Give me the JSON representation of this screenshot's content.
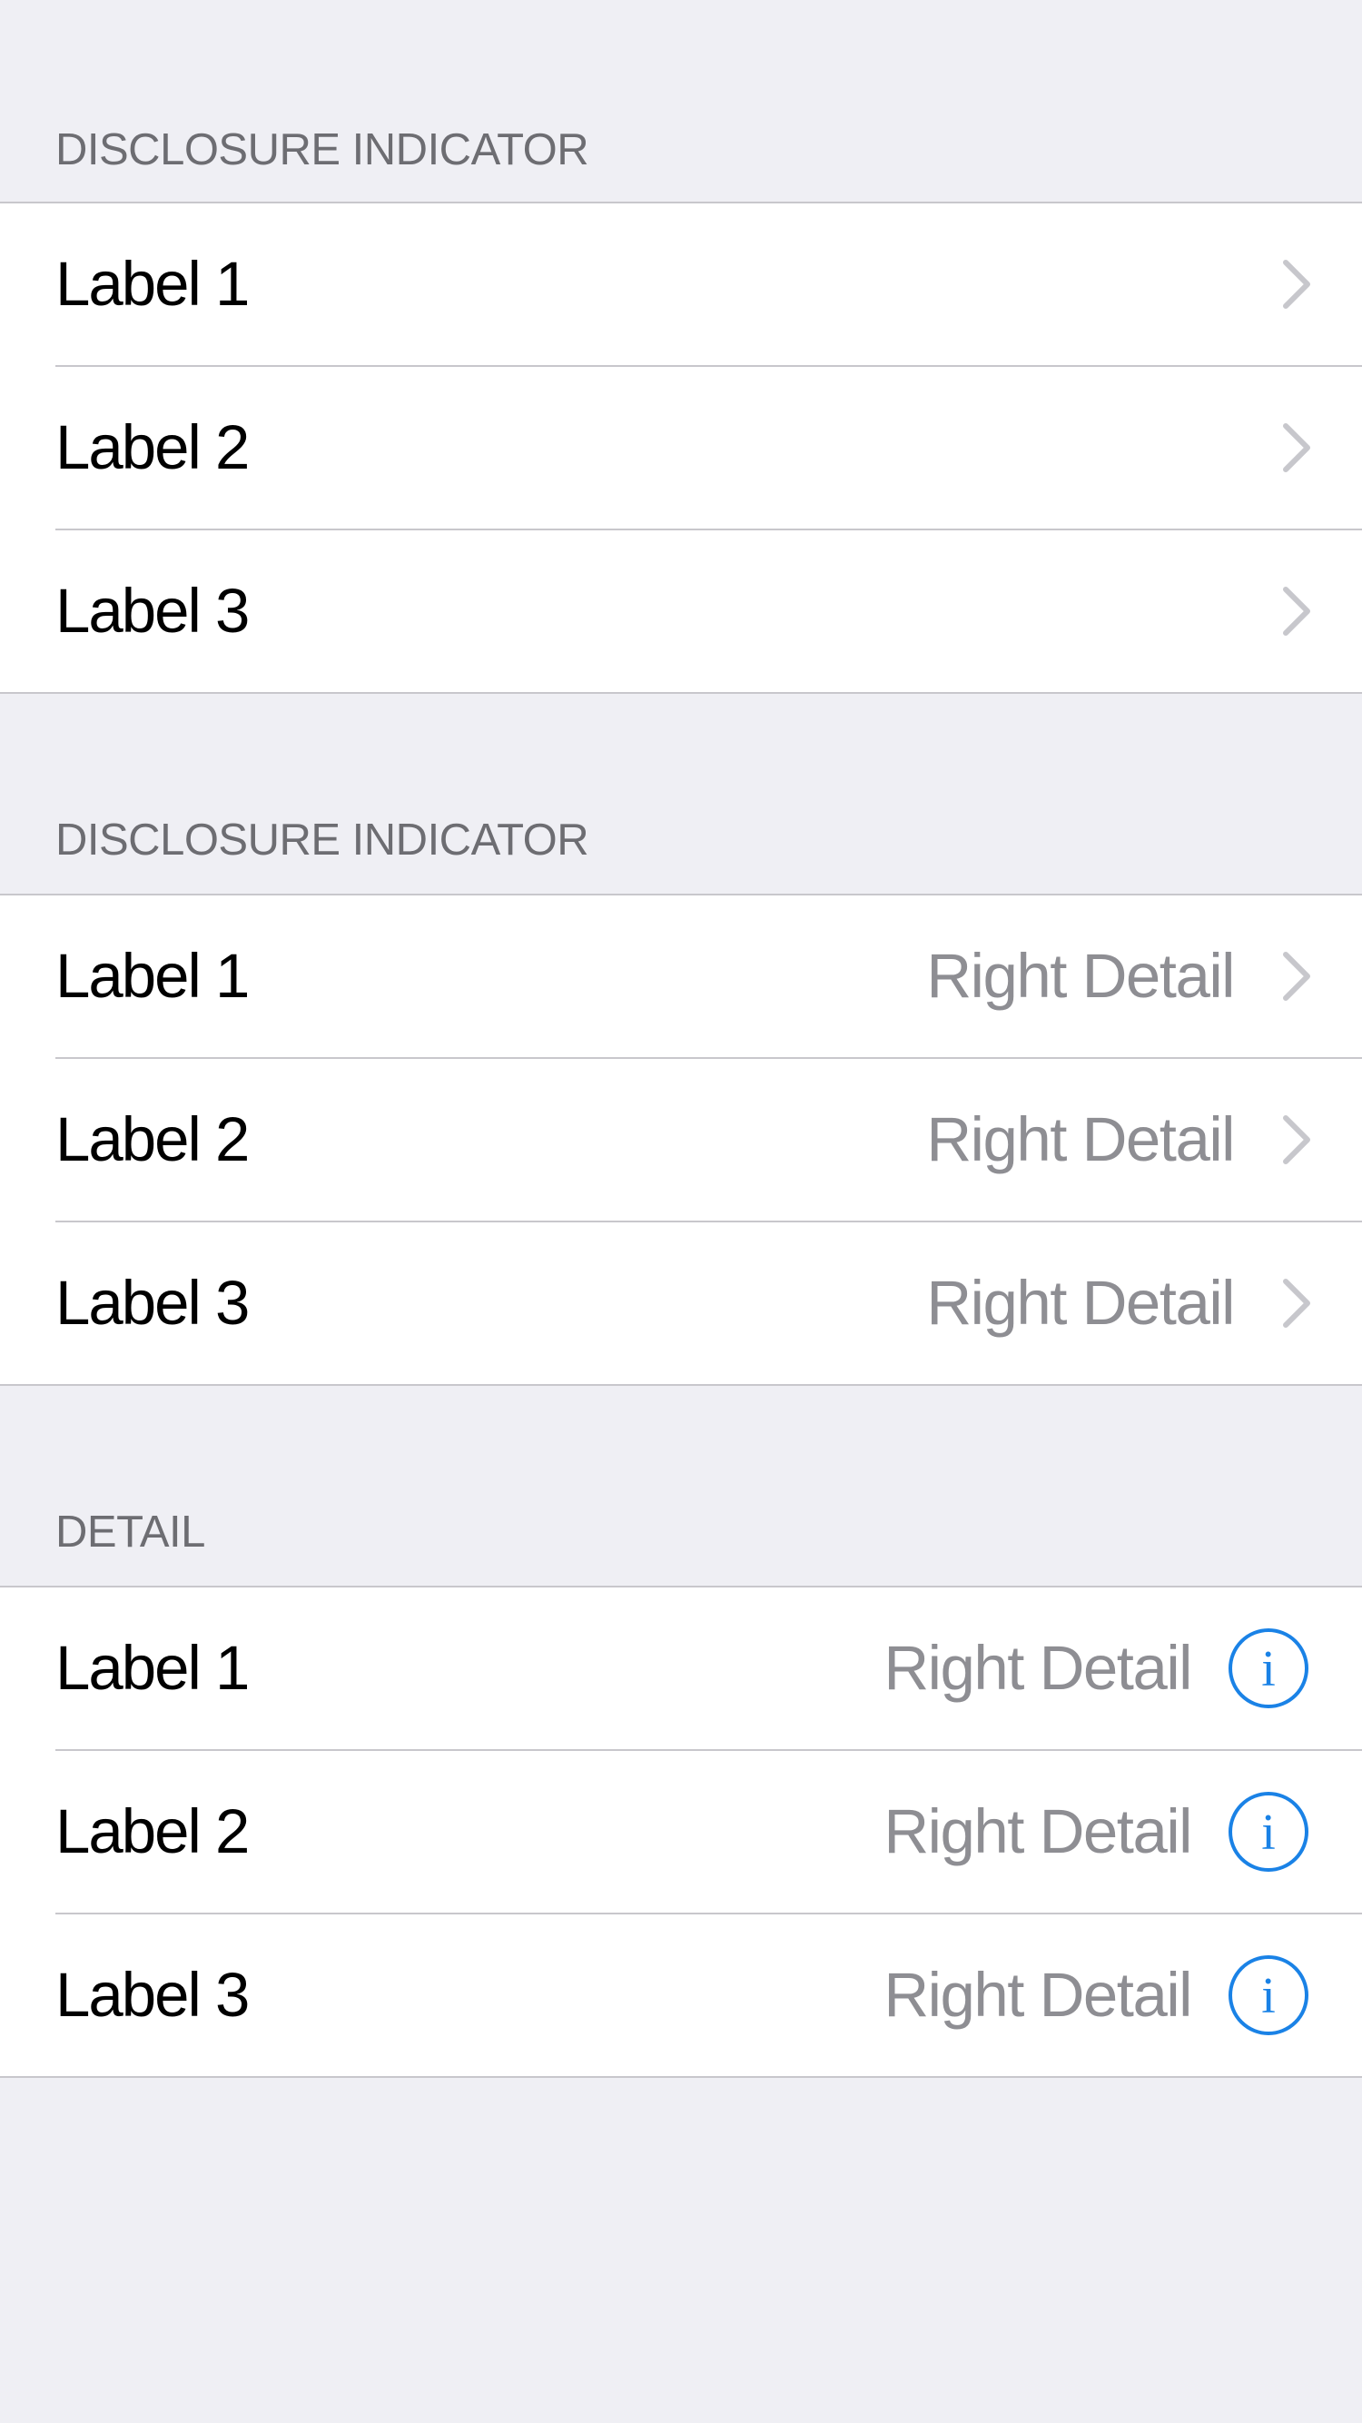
{
  "colors": {
    "background": "#efeff4",
    "cell": "#ffffff",
    "separator": "#c8c7cc",
    "header_text": "#6d6d72",
    "label_text": "#000000",
    "detail_text": "#8e8e93",
    "chevron": "#c7c7cc",
    "info_accent": "#1a82e6"
  },
  "sections": [
    {
      "header": "DISCLOSURE INDICATOR",
      "accessory": "chevron-icon",
      "rows": [
        {
          "label": "Label 1"
        },
        {
          "label": "Label 2"
        },
        {
          "label": "Label 3"
        }
      ]
    },
    {
      "header": "DISCLOSURE INDICATOR",
      "accessory": "chevron-icon",
      "rows": [
        {
          "label": "Label 1",
          "detail": "Right Detail"
        },
        {
          "label": "Label 2",
          "detail": "Right Detail"
        },
        {
          "label": "Label 3",
          "detail": "Right Detail"
        }
      ]
    },
    {
      "header": "DETAIL",
      "accessory": "info-icon",
      "rows": [
        {
          "label": "Label 1",
          "detail": "Right Detail"
        },
        {
          "label": "Label 2",
          "detail": "Right Detail"
        },
        {
          "label": "Label 3",
          "detail": "Right Detail"
        }
      ]
    }
  ]
}
